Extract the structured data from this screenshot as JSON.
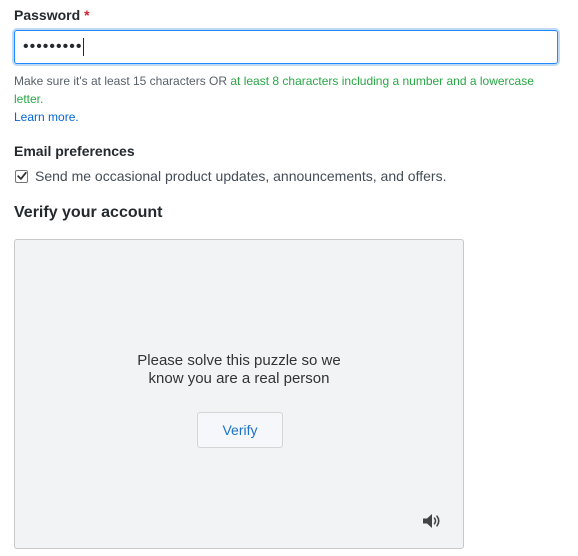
{
  "password": {
    "label": "Password",
    "required_marker": "*",
    "masked_value": "•••••••••"
  },
  "hint": {
    "part1": "Make sure it's at least 15 characters OR ",
    "part2_green": "at least 8 characters including a number and a lowercase letter.",
    "learn_more": "Learn more."
  },
  "email_preferences": {
    "label": "Email preferences",
    "checkbox_label": "Send me occasional product updates, announcements, and offers.",
    "checked": true
  },
  "verify": {
    "heading": "Verify your account",
    "puzzle_line1": "Please solve this puzzle so we",
    "puzzle_line2": "know you are a real person",
    "button_label": "Verify"
  },
  "icons": {
    "audio": "speaker-icon",
    "check": "checkmark-icon"
  },
  "colors": {
    "required": "#cb2431",
    "focus_border": "#2188ff",
    "hint_green": "#28a745",
    "link": "#0366d6",
    "verify_button_text": "#1a73c8"
  }
}
